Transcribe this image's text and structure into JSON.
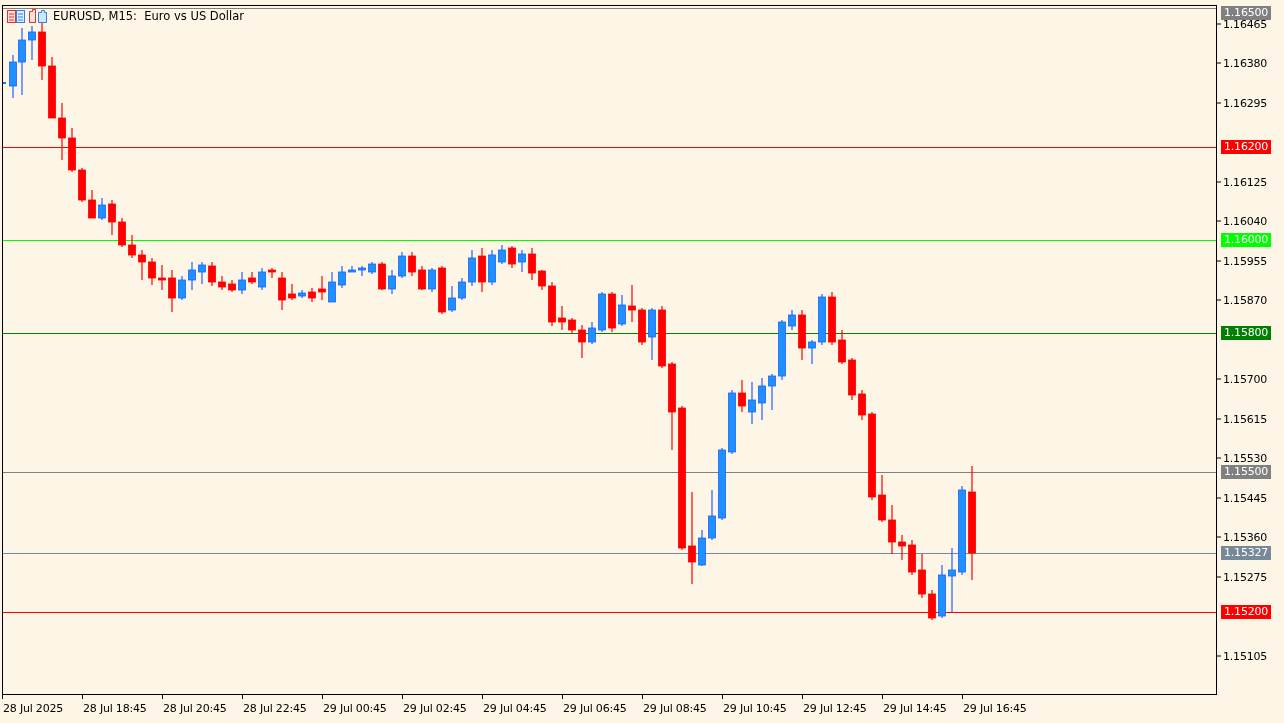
{
  "chart_header": {
    "title": "EURUSD, M15:  Euro vs US Dollar"
  },
  "price_axis": {
    "ticks": [
      "1.16465",
      "1.16380",
      "1.16295",
      "1.16125",
      "1.16040",
      "1.15955",
      "1.15870",
      "1.15700",
      "1.15615",
      "1.15530",
      "1.15445",
      "1.15360",
      "1.15275",
      "1.15105"
    ]
  },
  "levels": [
    {
      "label": "1.16500",
      "color": "#808080"
    },
    {
      "label": "1.16200",
      "color": "#ff0000"
    },
    {
      "label": "1.16000",
      "color": "#00ff00"
    },
    {
      "label": "1.15800",
      "color": "#008000"
    },
    {
      "label": "1.15500",
      "color": "#808080"
    },
    {
      "label": "1.15327",
      "color": "#778899"
    },
    {
      "label": "1.15200",
      "color": "#ff0000"
    }
  ],
  "time_axis": {
    "labels": [
      "28 Jul 2025",
      "28 Jul 18:45",
      "28 Jul 20:45",
      "28 Jul 22:45",
      "29 Jul 00:45",
      "29 Jul 02:45",
      "29 Jul 04:45",
      "29 Jul 06:45",
      "29 Jul 08:45",
      "29 Jul 10:45",
      "29 Jul 12:45",
      "29 Jul 14:45",
      "29 Jul 16:45"
    ]
  }
}
